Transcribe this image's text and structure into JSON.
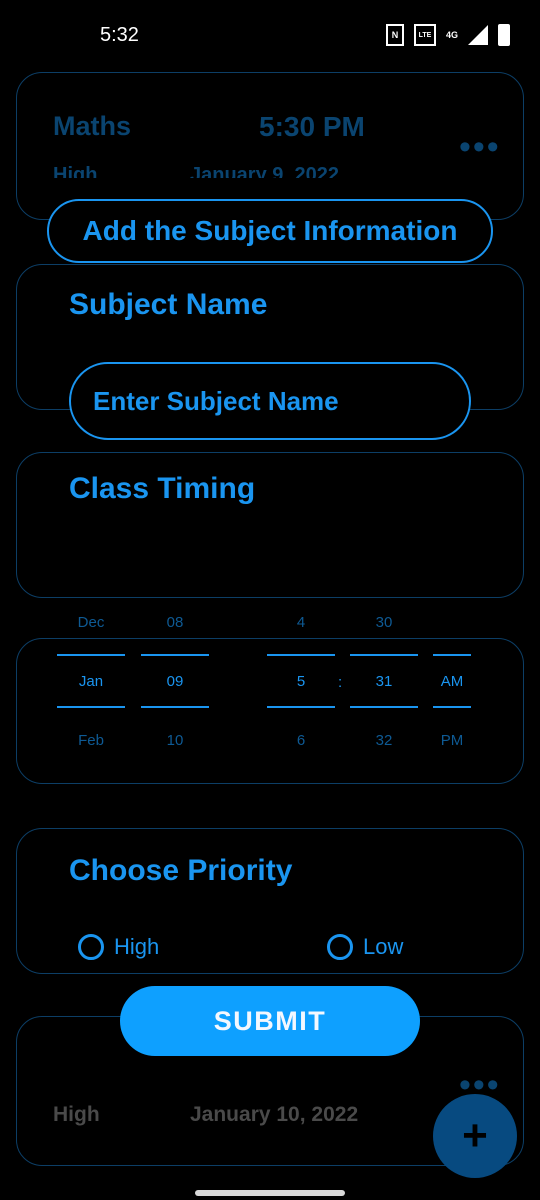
{
  "status_bar": {
    "time": "5:32",
    "nfc": "N",
    "volte": "VoLTE",
    "network": "4G"
  },
  "background_cards": {
    "card1": {
      "subject": "Maths",
      "time": "5:30 PM",
      "priority": "High",
      "date": "January 9, 2022"
    },
    "card_last": {
      "priority": "High",
      "date": "January 10, 2022"
    },
    "more_symbol": "•••"
  },
  "dialog": {
    "title": "Add the Subject Information",
    "subject_label": "Subject Name",
    "subject_placeholder": "Enter Subject Name",
    "timing_label": "Class Timing",
    "picker": {
      "month": {
        "prev": "Dec",
        "selected": "Jan",
        "next": "Feb"
      },
      "day": {
        "prev": "08",
        "selected": "09",
        "next": "10"
      },
      "hour": {
        "prev": "4",
        "selected": "5",
        "next": "6"
      },
      "separator": ":",
      "minute": {
        "prev": "30",
        "selected": "31",
        "next": "32"
      },
      "ampm": {
        "selected": "AM",
        "next": "PM"
      }
    },
    "priority_label": "Choose Priority",
    "priority_options": {
      "high": "High",
      "low": "Low"
    },
    "submit_label": "SUBMIT"
  },
  "fab": {
    "symbol": "+"
  },
  "colors": {
    "accent": "#1a95f0",
    "submit_bg": "#0ea0ff",
    "fab_bg": "#074a80",
    "background": "#000000"
  }
}
